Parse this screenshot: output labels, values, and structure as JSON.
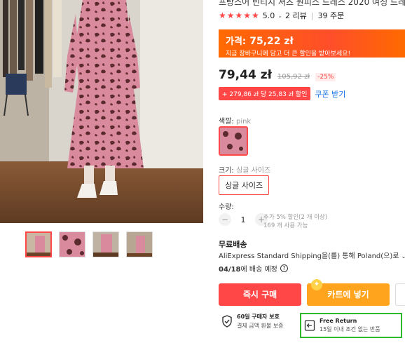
{
  "gallery": {
    "thumbnail_count": 4,
    "active_thumbnail": 0
  },
  "product": {
    "title": "프랑스어 빈티지 셔츠 원피스 드레스 2020 여성 드레스 긴 소매",
    "rating": "5.0",
    "reviews": "2 리뷰",
    "orders": "39 주문"
  },
  "promo": {
    "label": "가격:",
    "amount": "75,22 zł",
    "subtext": "지금 장바구니에 담고 더 큰 할인을 받아보세요!"
  },
  "price": {
    "current": "79,44 zł",
    "original": "105,92 zł",
    "discount": "-25%"
  },
  "coupon": {
    "tag": "+ 279,86 zł 당 25,83 zł 할인",
    "link": "쿠폰 받기"
  },
  "color": {
    "label": "색깔:",
    "value": "pink"
  },
  "size": {
    "label": "크기:",
    "value": "싱글 사이즈",
    "option": "싱글 사이즈"
  },
  "quantity": {
    "label": "수량:",
    "value": "1",
    "minus": "−",
    "plus": "+",
    "note1": "추가 5% 할인(2 개 이상)",
    "note2": "169 개 사용 가능"
  },
  "shipping": {
    "title": "무료배송",
    "line": "AliExpress Standard Shipping을(를) 통해 Poland(으)로",
    "date": "04/18",
    "date_suffix": "에 배송 예정",
    "help": "?"
  },
  "actions": {
    "buy": "즉시 구매",
    "cart": "카트에 넣기"
  },
  "protection": {
    "title": "60일 구매자 보호",
    "sub": "결제 금액 환불 보증"
  },
  "free_return": {
    "title": "Free Return",
    "sub": "15일 이내 조건 없는 반품"
  },
  "colors": {
    "accent": "#ff4747",
    "promo": "#ff6a00",
    "cart": "#ffa41c",
    "link": "#1a73e8",
    "highlight": "#2eb82e"
  }
}
